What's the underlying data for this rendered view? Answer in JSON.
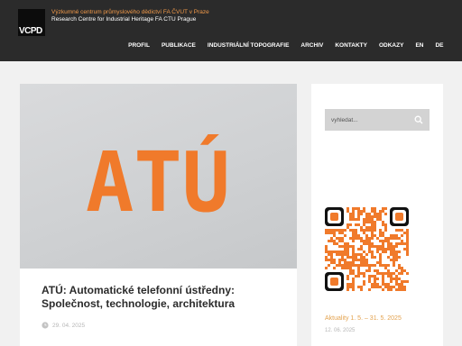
{
  "header": {
    "logo_text": "VCPD",
    "institution_cz": "Výzkumné centrum průmyslového dědictví FA ČVUT v Praze",
    "institution_en": "Research Centre for Industrial Heritage FA CTU Prague"
  },
  "nav": {
    "items": [
      "PROFIL",
      "PUBLIKACE",
      "INDUSTRIÁLNÍ TOPOGRAFIE",
      "ARCHIV",
      "KONTAKTY",
      "ODKAZY",
      "EN",
      "DE"
    ]
  },
  "post": {
    "image_text": "ATÚ",
    "title": "ATÚ: Automatické telefonní ústředny: Společnost, technologie, architektura",
    "date": "29. 04. 2025"
  },
  "sidebar": {
    "search_placeholder": "vyhledat...",
    "news_title": "Aktuality 1. 5. – 31. 5. 2025",
    "news_date": "12. 06. 2025"
  },
  "colors": {
    "header_bg": "#2b2b2b",
    "accent_orange": "#f07a2b",
    "link_orange": "#e3a24e",
    "subtitle_orange": "#f29a4a"
  },
  "icons": [
    "search-icon",
    "clock-icon"
  ]
}
